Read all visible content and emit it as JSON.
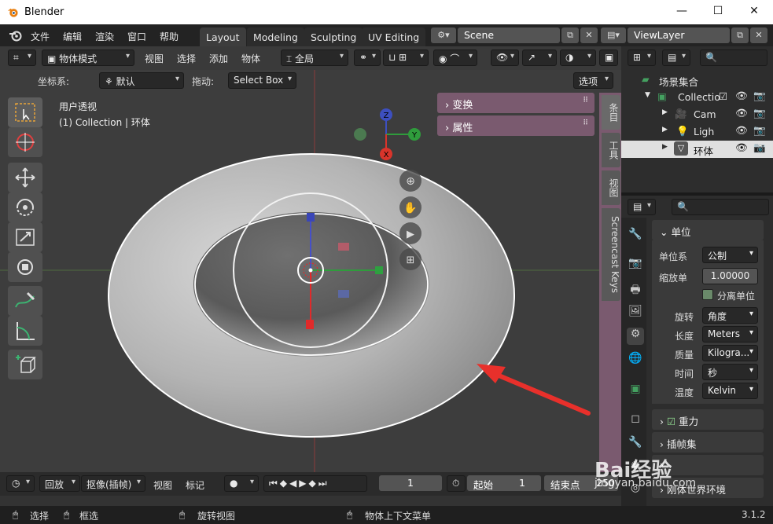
{
  "window": {
    "title": "Blender",
    "minimize": "—",
    "maximize": "☐",
    "close": "✕"
  },
  "menubar": {
    "items": [
      "文件",
      "编辑",
      "渲染",
      "窗口",
      "帮助"
    ]
  },
  "workspace_tabs": [
    "Layout",
    "Modeling",
    "Sculpting",
    "UV Editing"
  ],
  "scene": {
    "value": "Scene"
  },
  "viewlayer": {
    "value": "ViewLayer"
  },
  "viewport_header": {
    "mode": "物体模式",
    "menus": [
      "视图",
      "选择",
      "添加",
      "物体"
    ],
    "orientation": "全局"
  },
  "tool_settings": {
    "coord_label": "坐标系:",
    "coord_value": "默认",
    "drag_label": "拖动:",
    "drag_value": "Select Box",
    "options": "选项"
  },
  "viewport": {
    "view_name": "用户透视",
    "collection_info": "(1) Collection | 环体",
    "gizmo": {
      "z": "Z",
      "y": "Y",
      "x": "X"
    }
  },
  "npanel": {
    "transform": "变换",
    "attributes": "属性",
    "tabs": [
      "条目",
      "工具",
      "视图",
      "Screencast Keys"
    ]
  },
  "timeline": {
    "playback": "回放",
    "keying": "抠像(插帧)",
    "view": "视图",
    "markers": "标记",
    "current_frame": "1",
    "start_label": "起始",
    "start": "1",
    "end_label": "结束点",
    "end": "250"
  },
  "outliner": {
    "scene_collection": "场景集合",
    "items": [
      {
        "name": "Collectio"
      },
      {
        "name": "Cam"
      },
      {
        "name": "Ligh"
      },
      {
        "name": "环体"
      }
    ]
  },
  "properties": {
    "section_units": "单位",
    "rows": [
      {
        "label": "单位系",
        "value": "公制"
      },
      {
        "label": "缩放单",
        "value": "1.00000"
      },
      {
        "label": "",
        "value": "分离单位"
      },
      {
        "label": "旋转",
        "value": "角度"
      },
      {
        "label": "长度",
        "value": "Meters"
      },
      {
        "label": "质量",
        "value": "Kilogra..."
      },
      {
        "label": "时间",
        "value": "秒"
      },
      {
        "label": "温度",
        "value": "Kelvin"
      }
    ],
    "sections": [
      "重力",
      "插帧集",
      "",
      "刚体世界环境"
    ]
  },
  "status": {
    "select": "选择",
    "box_select": "框选",
    "rotate_view": "旋转视图",
    "context_menu": "物体上下文菜单",
    "version": "3.1.2"
  },
  "watermark": {
    "brand": "Bai经验",
    "url": "jingyan.baidu.com"
  },
  "colors": {
    "accent": "#4772b3",
    "npanel": "#7a5a6f",
    "arrow": "#e8302b",
    "x_axis": "#d9342b",
    "y_axis": "#2f9c3c",
    "z_axis": "#3d4fbf"
  }
}
